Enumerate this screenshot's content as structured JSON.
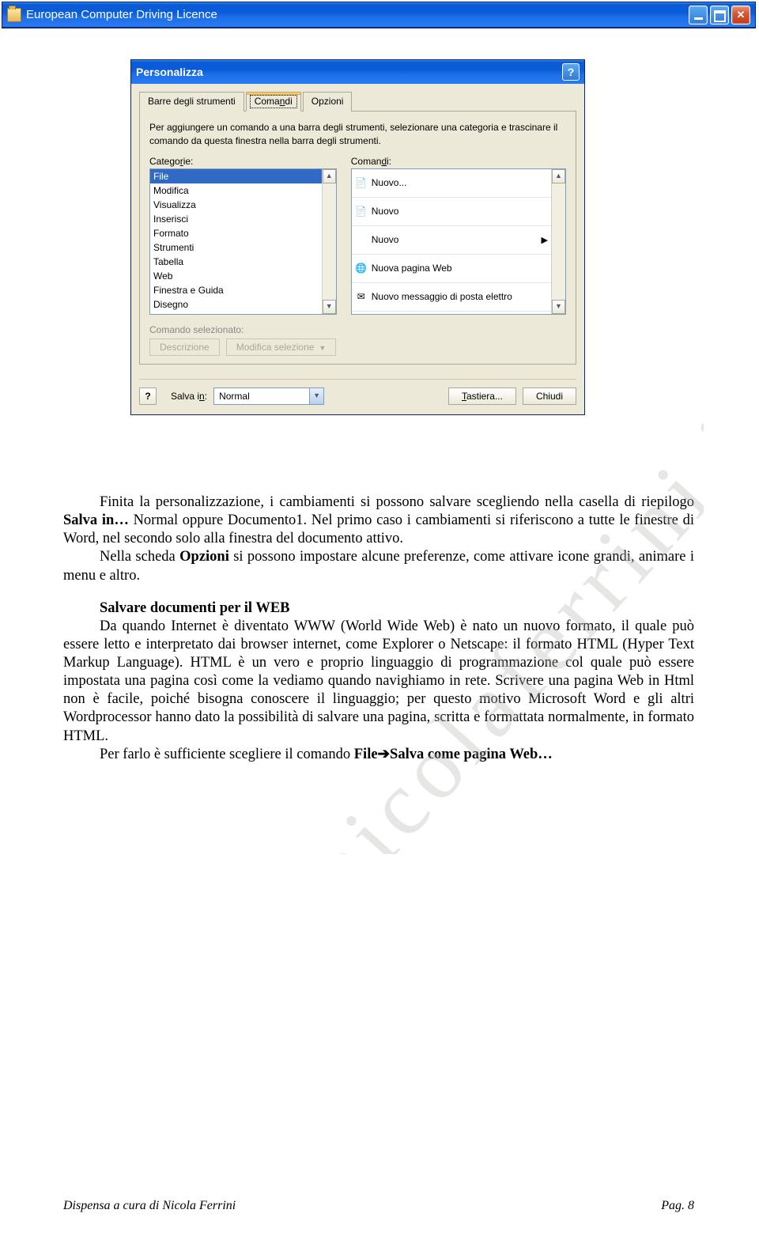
{
  "parent_window": {
    "title": "European Computer Driving Licence"
  },
  "dialog": {
    "title": "Personalizza",
    "tabs": {
      "toolbars": "Barre degli strumenti",
      "commands": "Comandi",
      "options": "Opzioni"
    },
    "instruction": "Per aggiungere un comando a una barra degli strumenti, selezionare una categoria e trascinare il comando da questa finestra nella barra degli strumenti.",
    "categories_label": "Categorie:",
    "commands_label": "Comandi:",
    "categories": [
      "File",
      "Modifica",
      "Visualizza",
      "Inserisci",
      "Formato",
      "Strumenti",
      "Tabella",
      "Web",
      "Finestra e Guida",
      "Disegno"
    ],
    "commands": [
      {
        "icon": "📄",
        "label": "Nuovo...",
        "arrow": false
      },
      {
        "icon": "📄",
        "label": "Nuovo",
        "arrow": false
      },
      {
        "icon": "",
        "label": "Nuovo",
        "arrow": true
      },
      {
        "icon": "🌐",
        "label": "Nuova pagina Web",
        "arrow": false
      },
      {
        "icon": "✉",
        "label": "Nuovo messaggio di posta elettro",
        "arrow": false
      }
    ],
    "selected_label": "Comando selezionato:",
    "desc_btn": "Descrizione",
    "modify_btn": "Modifica selezione",
    "save_in_label": "Salva in:",
    "save_in_value": "Normal",
    "keyboard_btn": "Tastiera...",
    "close_btn": "Chiudi"
  },
  "document": {
    "p1a": "Finita la personalizzazione, i cambiamenti si possono salvare scegliendo nella casella di riepilogo ",
    "p1b": "Salva in…",
    "p1c": " Normal oppure Documento1. Nel primo caso i cambiamenti si riferiscono a tutte le finestre di Word, nel secondo solo alla finestra del documento attivo.",
    "p2a": "Nella scheda ",
    "p2b": "Opzioni",
    "p2c": " si possono impostare alcune preferenze, come attivare icone grandi, animare i menu e altro.",
    "h": "Salvare documenti per il WEB",
    "p3": "Da quando Internet è diventato WWW (World Wide Web) è nato un nuovo formato, il quale può essere letto e interpretato dai browser internet, come Explorer o Netscape: il formato HTML (Hyper Text Markup Language). HTML è un vero e proprio linguaggio di programmazione col quale può essere impostata una pagina così come la vediamo quando navighiamo in rete. Scrivere una pagina Web in Html non è facile, poiché bisogna conoscere il linguaggio; per questo motivo Microsoft Word e gli altri Wordprocessor hanno dato la possibilità di salvare una pagina, scritta e formattata normalmente, in formato HTML.",
    "p4a": "Per farlo è sufficiente scegliere il comando ",
    "p4b": "File➔Salva come pagina Web…"
  },
  "watermark": "nicolaferrini.it",
  "footer": {
    "left": "Dispensa a cura di Nicola Ferrini",
    "right": "Pag. 8"
  }
}
